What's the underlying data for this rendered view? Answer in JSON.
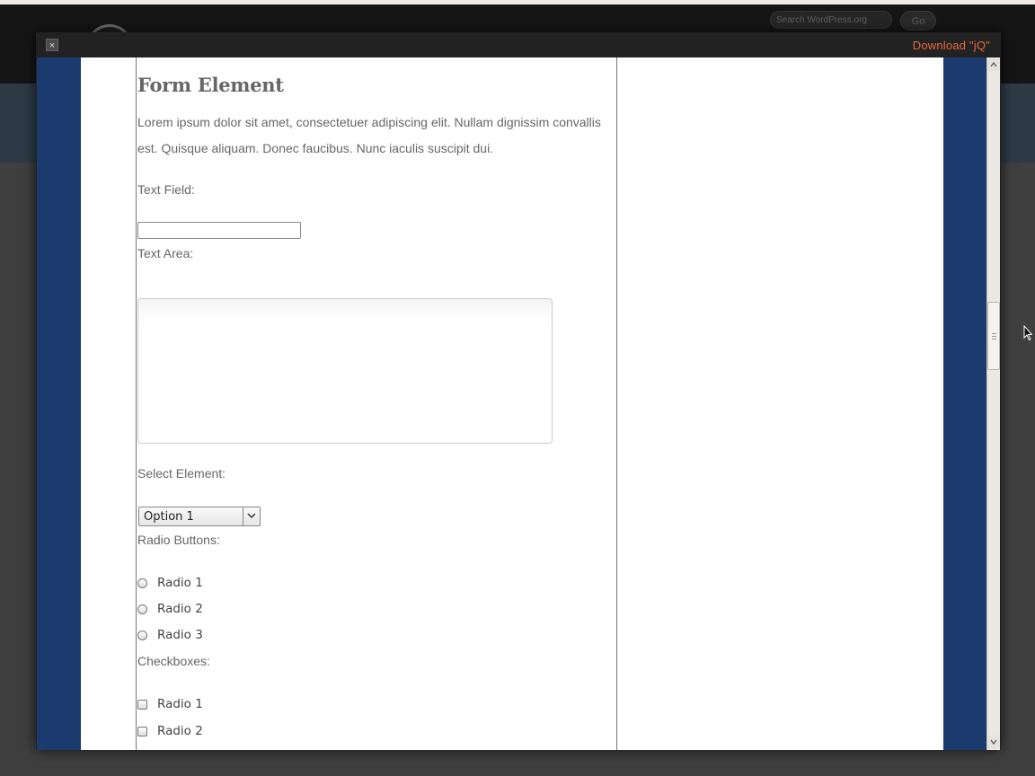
{
  "background": {
    "search_placeholder": "Search WordPress.org",
    "go_label": "Go"
  },
  "modal": {
    "close_label": "×",
    "download_label": "Download \"jQ\""
  },
  "content": {
    "title": "Form Element",
    "intro": "Lorem ipsum dolor sit amet, consectetuer adipiscing elit. Nullam dignissim convallis est. Quisque aliquam. Donec faucibus. Nunc iaculis suscipit dui.",
    "text_field_label": "Text Field:",
    "text_field_value": "",
    "text_area_label": "Text Area:",
    "select_label": "Select Element:",
    "select_value": "Option 1",
    "radio_label": "Radio Buttons:",
    "radios": [
      "Radio 1",
      "Radio 2",
      "Radio 3"
    ],
    "checkbox_label": "Checkboxes:",
    "checkboxes": [
      "Radio 1",
      "Radio 2"
    ]
  },
  "colors": {
    "accent_link": "#e8693a",
    "preview_background": "#1b3a6e"
  },
  "icons": {
    "close": "close-icon",
    "select_arrow": "chevron-down-icon",
    "scroll_up": "arrow-up-icon",
    "scroll_down": "arrow-down-icon",
    "cursor": "mouse-pointer-icon"
  }
}
